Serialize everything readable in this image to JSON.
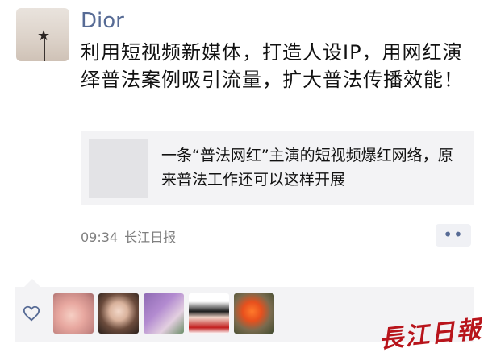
{
  "post": {
    "username": "Dior",
    "text": "利用短视频新媒体，打造人设IP，用网红演绎普法案例吸引流量，扩大普法传播效能！",
    "link": {
      "title": "一条“普法网红”主演的短视频爆红网络，原来普法工作还可以这样开展"
    },
    "time": "09:34",
    "source": "长江日报",
    "more_label": "••"
  },
  "likes": {
    "icon": "heart-outline-icon",
    "avatars": [
      "liker-avatar-1",
      "liker-avatar-2",
      "liker-avatar-3",
      "liker-avatar-4",
      "liker-avatar-5"
    ]
  },
  "watermark": {
    "text": "長江日報"
  },
  "colors": {
    "username": "#576b95",
    "card_bg": "#f3f3f5",
    "meta": "#7f7f7f",
    "watermark": "#b8141b"
  }
}
